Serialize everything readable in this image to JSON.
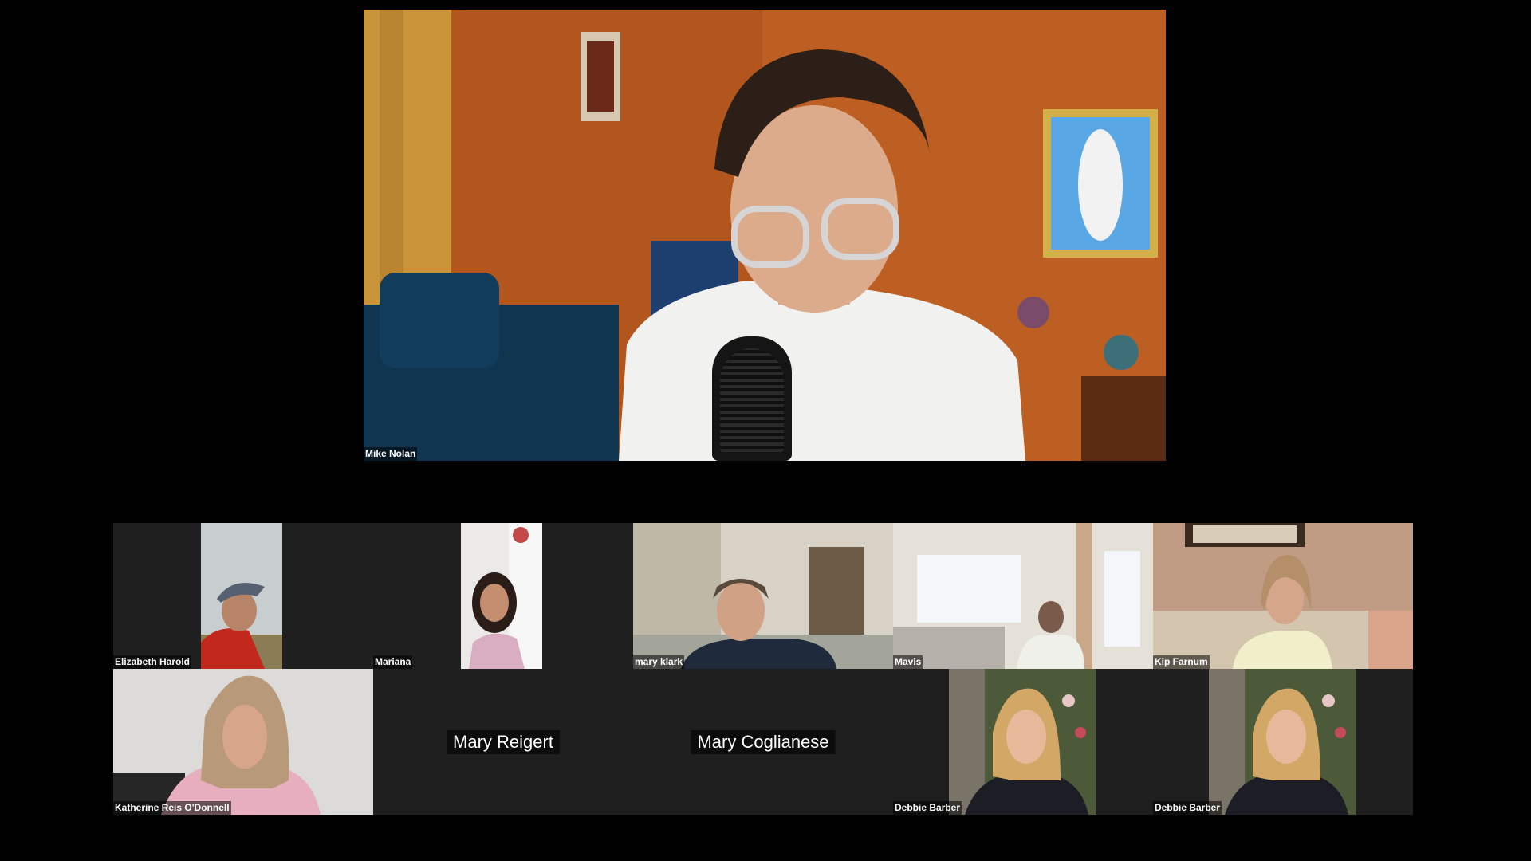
{
  "speaker": {
    "name": "Mike Nolan"
  },
  "gallery": {
    "row1": [
      {
        "name": "Elizabeth Harold"
      },
      {
        "name": "Mariana"
      },
      {
        "name": "mary klark"
      },
      {
        "name": "Mavis"
      },
      {
        "name": "Kip Farnum"
      }
    ],
    "row2": [
      {
        "name": "Katherine Reis O'Donnell"
      },
      {
        "name": "Mary Reigert"
      },
      {
        "name": "Mary Coglianese"
      },
      {
        "name": "Debbie Barber"
      },
      {
        "name": "Debbie Barber"
      }
    ]
  },
  "colors": {
    "background": "#000000",
    "tile_background": "#1f1f1f",
    "speaker_wall": "#b5571c"
  },
  "icons": [
    "microphone-icon"
  ]
}
